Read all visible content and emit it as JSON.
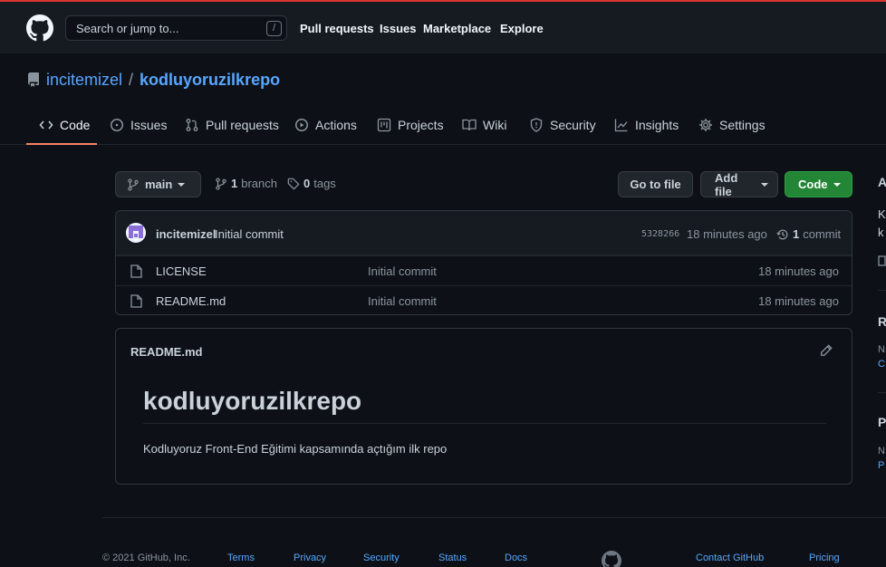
{
  "header": {
    "search_placeholder": "Search or jump to...",
    "search_key": "/",
    "nav": [
      "Pull requests",
      "Issues",
      "Marketplace",
      "Explore"
    ]
  },
  "repo": {
    "owner": "incitemizel",
    "separator": "/",
    "name": "kodluyoruzilkrepo"
  },
  "tabs": [
    {
      "label": "Code",
      "icon": "code-icon"
    },
    {
      "label": "Issues",
      "icon": "issue-icon"
    },
    {
      "label": "Pull requests",
      "icon": "pull-request-icon"
    },
    {
      "label": "Actions",
      "icon": "play-icon"
    },
    {
      "label": "Projects",
      "icon": "project-icon"
    },
    {
      "label": "Wiki",
      "icon": "book-icon"
    },
    {
      "label": "Security",
      "icon": "shield-icon"
    },
    {
      "label": "Insights",
      "icon": "graph-icon"
    },
    {
      "label": "Settings",
      "icon": "gear-icon"
    }
  ],
  "toolbar": {
    "branch": "main",
    "branch_count": "1",
    "branch_word": "branch",
    "tag_count": "0",
    "tag_word": "tags",
    "go_to_file": "Go to file",
    "add_file": "Add file",
    "code": "Code"
  },
  "commit": {
    "author": "incitemizel",
    "message": "Initial commit",
    "sha": "5328266",
    "time": "18 minutes ago",
    "count": "1",
    "count_word": "commit"
  },
  "files": [
    {
      "name": "LICENSE",
      "message": "Initial commit",
      "time": "18 minutes ago"
    },
    {
      "name": "README.md",
      "message": "Initial commit",
      "time": "18 minutes ago"
    }
  ],
  "readme": {
    "filename": "README.md",
    "title": "kodluyoruzilkrepo",
    "text": "Kodluyoruz Front-End Eğitimi kapsamında açtığım ilk repo"
  },
  "sidebar": {
    "about_h": "A",
    "about_line1": "K",
    "about_line2": "k",
    "releases_h": "R",
    "releases_muted": "N",
    "releases_link": "C",
    "packages_h": "P",
    "packages_muted": "N",
    "packages_link": "P"
  },
  "footer": {
    "copyright": "© 2021 GitHub, Inc.",
    "links": [
      "Terms",
      "Privacy",
      "Security",
      "Status",
      "Docs",
      "Contact GitHub",
      "Pricing"
    ]
  },
  "colors": {
    "accent_link": "#58a6ff",
    "primary_button": "#238636",
    "active_tab_underline": "#f78166",
    "background": "#0d1117"
  }
}
